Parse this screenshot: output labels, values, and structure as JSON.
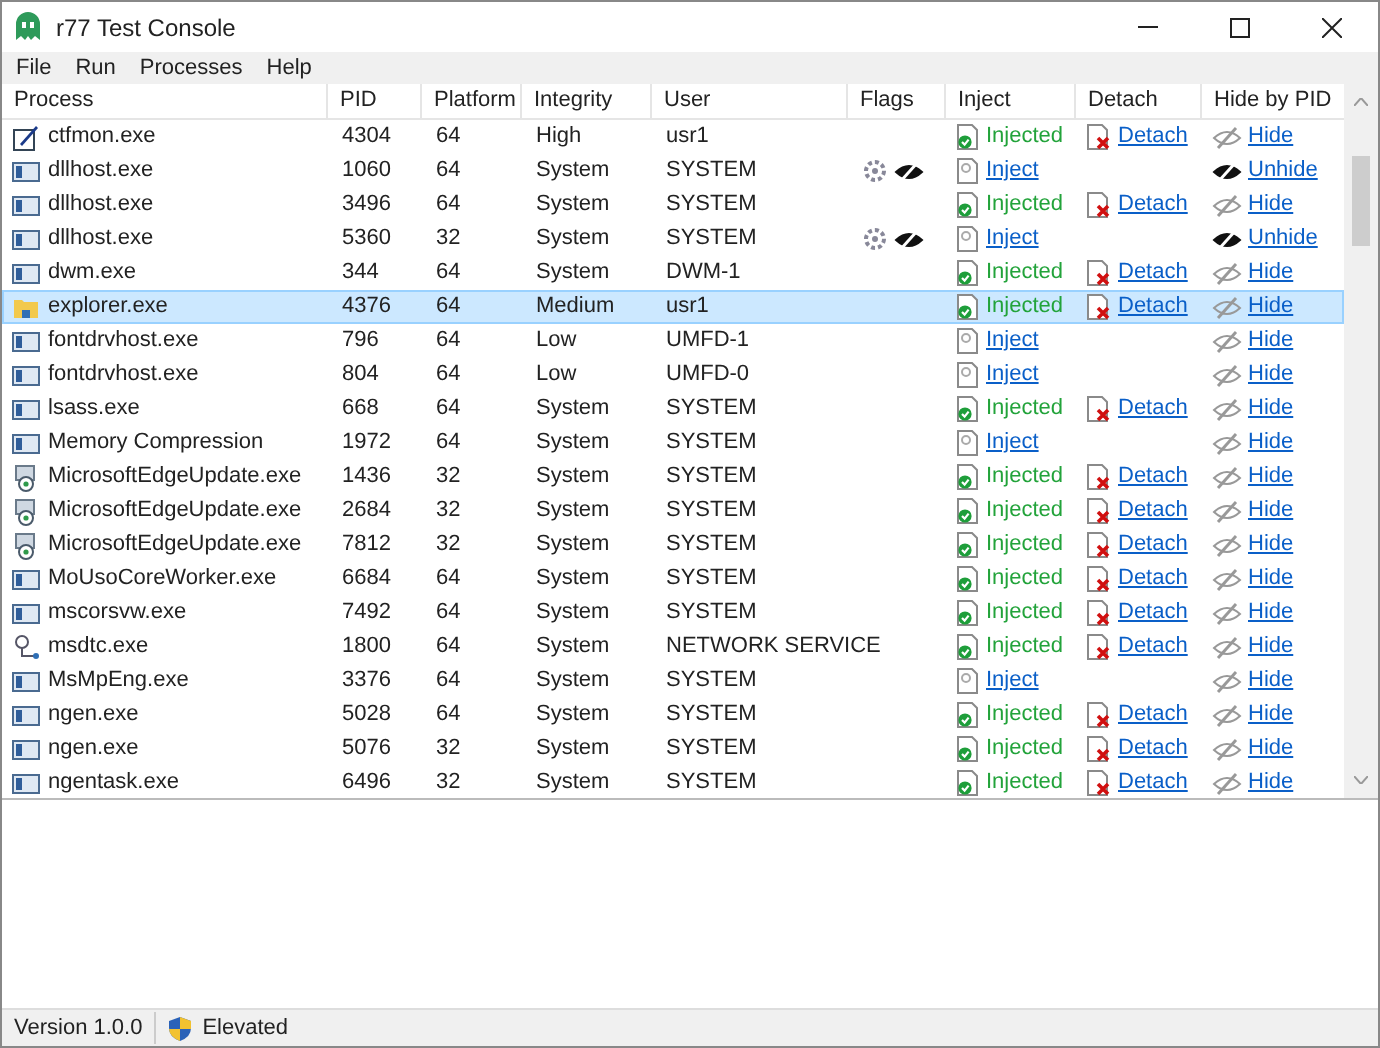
{
  "window": {
    "title": "r77 Test Console"
  },
  "menu": [
    "File",
    "Run",
    "Processes",
    "Help"
  ],
  "table": {
    "columns": [
      "Process",
      "PID",
      "Platform",
      "Integrity",
      "User",
      "Flags",
      "Inject",
      "Detach",
      "Hide by PID"
    ],
    "rows": [
      {
        "kind": "pen",
        "process": "ctfmon.exe",
        "pid": "4304",
        "platform": "64",
        "integrity": "High",
        "user": "usr1",
        "injected": true,
        "inject": "Injected",
        "detach": "Detach",
        "hidden": false,
        "hide": "Hide",
        "selected": false
      },
      {
        "kind": "window",
        "process": "dllhost.exe",
        "pid": "1060",
        "platform": "64",
        "integrity": "System",
        "user": "SYSTEM",
        "injected": false,
        "inject": "Inject",
        "hidden": true,
        "hide": "Unhide",
        "selected": false
      },
      {
        "kind": "window",
        "process": "dllhost.exe",
        "pid": "3496",
        "platform": "64",
        "integrity": "System",
        "user": "SYSTEM",
        "injected": true,
        "inject": "Injected",
        "detach": "Detach",
        "hidden": false,
        "hide": "Hide",
        "selected": false
      },
      {
        "kind": "window",
        "process": "dllhost.exe",
        "pid": "5360",
        "platform": "32",
        "integrity": "System",
        "user": "SYSTEM",
        "injected": false,
        "inject": "Inject",
        "hidden": true,
        "hide": "Unhide",
        "selected": false
      },
      {
        "kind": "window",
        "process": "dwm.exe",
        "pid": "344",
        "platform": "64",
        "integrity": "System",
        "user": "DWM-1",
        "injected": true,
        "inject": "Injected",
        "detach": "Detach",
        "hidden": false,
        "hide": "Hide",
        "selected": false
      },
      {
        "kind": "folder",
        "process": "explorer.exe",
        "pid": "4376",
        "platform": "64",
        "integrity": "Medium",
        "user": "usr1",
        "injected": true,
        "inject": "Injected",
        "detach": "Detach",
        "hidden": false,
        "hide": "Hide",
        "selected": true
      },
      {
        "kind": "window",
        "process": "fontdrvhost.exe",
        "pid": "796",
        "platform": "64",
        "integrity": "Low",
        "user": "UMFD-1",
        "injected": false,
        "inject": "Inject",
        "hidden": false,
        "hide": "Hide",
        "selected": false
      },
      {
        "kind": "window",
        "process": "fontdrvhost.exe",
        "pid": "804",
        "platform": "64",
        "integrity": "Low",
        "user": "UMFD-0",
        "injected": false,
        "inject": "Inject",
        "hidden": false,
        "hide": "Hide",
        "selected": false
      },
      {
        "kind": "window",
        "process": "lsass.exe",
        "pid": "668",
        "platform": "64",
        "integrity": "System",
        "user": "SYSTEM",
        "injected": true,
        "inject": "Injected",
        "detach": "Detach",
        "hidden": false,
        "hide": "Hide",
        "selected": false
      },
      {
        "kind": "window",
        "process": "Memory Compression",
        "pid": "1972",
        "platform": "64",
        "integrity": "System",
        "user": "SYSTEM",
        "injected": false,
        "inject": "Inject",
        "hidden": false,
        "hide": "Hide",
        "selected": false
      },
      {
        "kind": "installer",
        "process": "MicrosoftEdgeUpdate.exe",
        "pid": "1436",
        "platform": "32",
        "integrity": "System",
        "user": "SYSTEM",
        "injected": true,
        "inject": "Injected",
        "detach": "Detach",
        "hidden": false,
        "hide": "Hide",
        "selected": false
      },
      {
        "kind": "installer",
        "process": "MicrosoftEdgeUpdate.exe",
        "pid": "2684",
        "platform": "32",
        "integrity": "System",
        "user": "SYSTEM",
        "injected": true,
        "inject": "Injected",
        "detach": "Detach",
        "hidden": false,
        "hide": "Hide",
        "selected": false
      },
      {
        "kind": "installer",
        "process": "MicrosoftEdgeUpdate.exe",
        "pid": "7812",
        "platform": "32",
        "integrity": "System",
        "user": "SYSTEM",
        "injected": true,
        "inject": "Injected",
        "detach": "Detach",
        "hidden": false,
        "hide": "Hide",
        "selected": false
      },
      {
        "kind": "window",
        "process": "MoUsoCoreWorker.exe",
        "pid": "6684",
        "platform": "64",
        "integrity": "System",
        "user": "SYSTEM",
        "injected": true,
        "inject": "Injected",
        "detach": "Detach",
        "hidden": false,
        "hide": "Hide",
        "selected": false
      },
      {
        "kind": "window",
        "process": "mscorsvw.exe",
        "pid": "7492",
        "platform": "64",
        "integrity": "System",
        "user": "SYSTEM",
        "injected": true,
        "inject": "Injected",
        "detach": "Detach",
        "hidden": false,
        "hide": "Hide",
        "selected": false
      },
      {
        "kind": "network",
        "process": "msdtc.exe",
        "pid": "1800",
        "platform": "64",
        "integrity": "System",
        "user": "NETWORK SERVICE",
        "injected": true,
        "inject": "Injected",
        "detach": "Detach",
        "hidden": false,
        "hide": "Hide",
        "selected": false
      },
      {
        "kind": "window",
        "process": "MsMpEng.exe",
        "pid": "3376",
        "platform": "64",
        "integrity": "System",
        "user": "SYSTEM",
        "injected": false,
        "inject": "Inject",
        "hidden": false,
        "hide": "Hide",
        "selected": false
      },
      {
        "kind": "window",
        "process": "ngen.exe",
        "pid": "5028",
        "platform": "64",
        "integrity": "System",
        "user": "SYSTEM",
        "injected": true,
        "inject": "Injected",
        "detach": "Detach",
        "hidden": false,
        "hide": "Hide",
        "selected": false
      },
      {
        "kind": "window",
        "process": "ngen.exe",
        "pid": "5076",
        "platform": "32",
        "integrity": "System",
        "user": "SYSTEM",
        "injected": true,
        "inject": "Injected",
        "detach": "Detach",
        "hidden": false,
        "hide": "Hide",
        "selected": false
      },
      {
        "kind": "window",
        "process": "ngentask.exe",
        "pid": "6496",
        "platform": "32",
        "integrity": "System",
        "user": "SYSTEM",
        "injected": true,
        "inject": "Injected",
        "detach": "Detach",
        "hidden": false,
        "hide": "Hide",
        "selected": false
      }
    ]
  },
  "status_bar": {
    "version": "Version 1.0.0",
    "elevation": "Elevated"
  }
}
